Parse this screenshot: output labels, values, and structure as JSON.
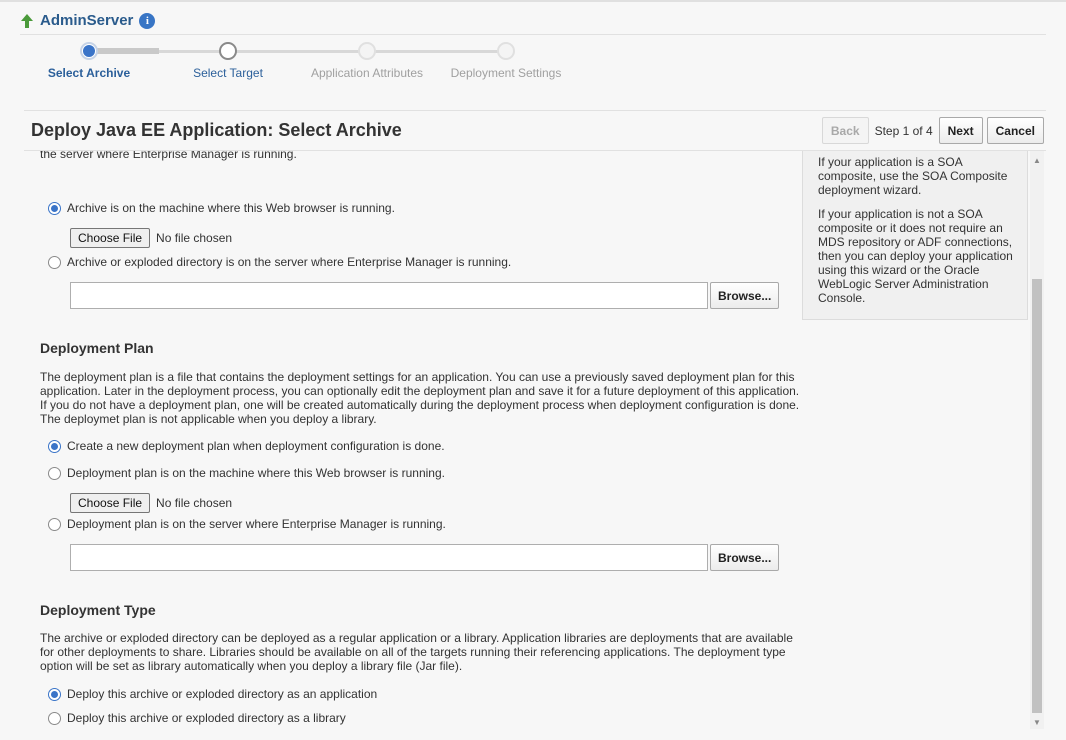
{
  "breadcrumb": {
    "title": "AdminServer",
    "info_icon": "i"
  },
  "train": {
    "steps": [
      {
        "label": "Select Archive",
        "state": "current"
      },
      {
        "label": "Select Target",
        "state": "next"
      },
      {
        "label": "Application Attributes",
        "state": "future"
      },
      {
        "label": "Deployment Settings",
        "state": "future"
      }
    ]
  },
  "header": {
    "title": "Deploy Java EE Application: Select Archive",
    "back_label": "Back",
    "step_info": "Step 1 of 4",
    "next_label": "Next",
    "cancel_label": "Cancel"
  },
  "archive": {
    "cut_text": "the server where Enterprise Manager is running.",
    "option_local": "Archive is on the machine where this Web browser is running.",
    "choose_file": "Choose File",
    "no_file": "No file chosen",
    "option_server": "Archive or exploded directory is on the server where Enterprise Manager is running.",
    "path_value": "",
    "browse_label": "Browse..."
  },
  "side_panel": {
    "p1": "If your application is a SOA composite, use the SOA Composite deployment wizard.",
    "p2": "If your application is not a SOA composite or it does not require an MDS repository or ADF connections, then you can deploy your application using this wizard or the Oracle WebLogic Server Administration Console."
  },
  "plan": {
    "title": "Deployment Plan",
    "description": "The deployment plan is a file that contains the deployment settings for an application. You can use a previously saved deployment plan for this application. Later in the deployment process, you can optionally edit the deployment plan and save it for a future deployment of this application. If you do not have a deployment plan, one will be created automatically during the deployment process when deployment configuration is done. The deploymet plan is not applicable when you deploy a library.",
    "option_create": "Create a new deployment plan when deployment configuration is done.",
    "option_local": "Deployment plan is on the machine where this Web browser is running.",
    "choose_file": "Choose File",
    "no_file": "No file chosen",
    "option_server": "Deployment plan is on the server where Enterprise Manager is running.",
    "path_value": "",
    "browse_label": "Browse..."
  },
  "type": {
    "title": "Deployment Type",
    "description": "The archive or exploded directory can be deployed as a regular application or a library. Application libraries are deployments that are available for other deployments to share. Libraries should be available on all of the targets running their referencing applications. The deployment type option will be set as library automatically when you deploy a library file (Jar file).",
    "option_app": "Deploy this archive or exploded directory as an application",
    "option_lib": "Deploy this archive or exploded directory as a library"
  },
  "colors": {
    "accent": "#3a74c8",
    "link": "#2a5b8c",
    "arrow": "#4a9a3a"
  }
}
